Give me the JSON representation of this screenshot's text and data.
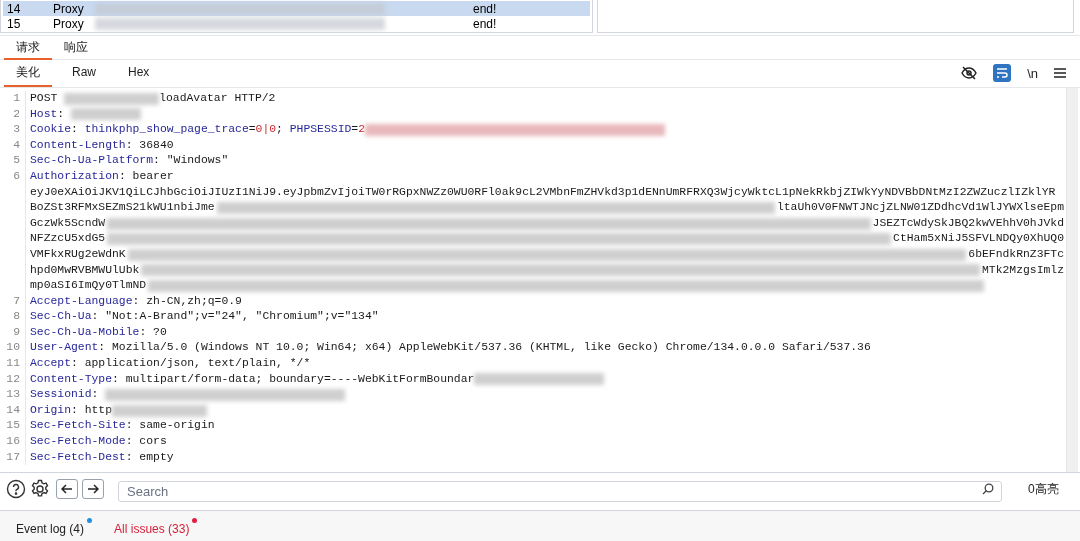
{
  "history_table": {
    "rows": [
      {
        "number": "14",
        "tool": "Proxy",
        "comment": "end!",
        "selected": true
      },
      {
        "number": "15",
        "tool": "Proxy",
        "comment": "end!",
        "selected": false
      }
    ]
  },
  "message_tabs": [
    {
      "label": "请求",
      "selected": true
    },
    {
      "label": "响应",
      "selected": false
    }
  ],
  "view_tabs": [
    {
      "label": "美化",
      "selected": true
    },
    {
      "label": "Raw",
      "selected": false
    },
    {
      "label": "Hex",
      "selected": false
    }
  ],
  "toolbar": {
    "newline_toggle": "\\n",
    "wrap_on": true
  },
  "request_lines": [
    {
      "number": "1",
      "parts": [
        {
          "kind": "plain",
          "text": "POST "
        },
        {
          "kind": "redacted"
        },
        {
          "kind": "plain",
          "text": "loadAvatar HTTP/2"
        }
      ]
    },
    {
      "number": "2",
      "parts": [
        {
          "kind": "key",
          "text": "Host"
        },
        {
          "kind": "plain",
          "text": ": "
        },
        {
          "kind": "redacted"
        }
      ]
    },
    {
      "number": "3",
      "parts": [
        {
          "kind": "key",
          "text": "Cookie"
        },
        {
          "kind": "plain",
          "text": ": "
        },
        {
          "kind": "key",
          "text": "thinkphp_show_page_trace"
        },
        {
          "kind": "plain",
          "text": "="
        },
        {
          "kind": "value",
          "text": "0|0"
        },
        {
          "kind": "plain",
          "text": "; "
        },
        {
          "kind": "key",
          "text": "PHPSESSID"
        },
        {
          "kind": "plain",
          "text": "="
        },
        {
          "kind": "value",
          "text": "2"
        },
        {
          "kind": "redacted_value"
        }
      ]
    },
    {
      "number": "4",
      "parts": [
        {
          "kind": "key",
          "text": "Content-Length"
        },
        {
          "kind": "plain",
          "text": ": 36840"
        }
      ]
    },
    {
      "number": "5",
      "parts": [
        {
          "kind": "key",
          "text": "Sec-Ch-Ua-Platform"
        },
        {
          "kind": "plain",
          "text": ": \"Windows\""
        }
      ]
    },
    {
      "number": "6",
      "parts": [
        {
          "kind": "key",
          "text": "Authorization"
        },
        {
          "kind": "plain",
          "text": ": bearer"
        }
      ],
      "wrapped": [
        {
          "parts": [
            {
              "kind": "plain",
              "text": "eyJ0eXAiOiJKV1QiLCJhbGciOiJIUzI1NiJ9.eyJpbmZvIjoiTW0rRGpxNWZz0WU0RFl0ak9cL2VMbnFmZHVkd3p1dENnUmRFRXQ3WjcyWktcL1pNekRkbjZIWkYyNDVBbDNtMzI2ZWZuczlIZklYR"
            }
          ]
        },
        {
          "parts": [
            {
              "kind": "plain",
              "text": "BoZSt3RFMxSEZmS21kWU1nbiJme"
            },
            {
              "kind": "redacted"
            },
            {
              "kind": "plain",
              "text": "ltaUh0V0FNWTJNcjZLNW01ZDdhcVd1WlJYWXlseEpm"
            }
          ]
        },
        {
          "parts": [
            {
              "kind": "plain",
              "text": "GczWk5ScndW"
            },
            {
              "kind": "redacted"
            },
            {
              "kind": "plain",
              "text": "JSEZTcWdySkJBQ2kwVEhhV0hJVkd"
            }
          ]
        },
        {
          "parts": [
            {
              "kind": "plain",
              "text": "NFZzcU5xdG5"
            },
            {
              "kind": "redacted"
            },
            {
              "kind": "plain",
              "text": "CtHam5xNiJ5SFVLNDQy0XhUQ0"
            }
          ]
        },
        {
          "parts": [
            {
              "kind": "plain",
              "text": "VMFkxRUg2eWdnK"
            },
            {
              "kind": "redacted"
            },
            {
              "kind": "plain",
              "text": "6bEFndkRnZ3FTc"
            }
          ]
        },
        {
          "parts": [
            {
              "kind": "plain",
              "text": "hpd0MwRVBMWUlUbk"
            },
            {
              "kind": "redacted"
            },
            {
              "kind": "plain",
              "text": "MTk2MzgsImlz"
            }
          ]
        },
        {
          "parts": [
            {
              "kind": "plain",
              "text": "mp0aSI6ImQy0TlmND"
            },
            {
              "kind": "redacted"
            }
          ]
        }
      ]
    },
    {
      "number": "7",
      "parts": [
        {
          "kind": "key",
          "text": "Accept-Language"
        },
        {
          "kind": "plain",
          "text": ": zh-CN,zh;q=0.9"
        }
      ]
    },
    {
      "number": "8",
      "parts": [
        {
          "kind": "key",
          "text": "Sec-Ch-Ua"
        },
        {
          "kind": "plain",
          "text": ": \"Not:A-Brand\";v=\"24\", \"Chromium\";v=\"134\""
        }
      ]
    },
    {
      "number": "9",
      "parts": [
        {
          "kind": "key",
          "text": "Sec-Ch-Ua-Mobile"
        },
        {
          "kind": "plain",
          "text": ": ?0"
        }
      ]
    },
    {
      "number": "10",
      "parts": [
        {
          "kind": "key",
          "text": "User-Agent"
        },
        {
          "kind": "plain",
          "text": ": Mozilla/5.0 (Windows NT 10.0; Win64; x64) AppleWebKit/537.36 (KHTML, like Gecko) Chrome/134.0.0.0 Safari/537.36"
        }
      ]
    },
    {
      "number": "11",
      "parts": [
        {
          "kind": "key",
          "text": "Accept"
        },
        {
          "kind": "plain",
          "text": ": application/json, text/plain, */*"
        }
      ]
    },
    {
      "number": "12",
      "parts": [
        {
          "kind": "key",
          "text": "Content-Type"
        },
        {
          "kind": "plain",
          "text": ": multipart/form-data; boundary=----WebKitFormBoundar"
        },
        {
          "kind": "redacted"
        }
      ]
    },
    {
      "number": "13",
      "parts": [
        {
          "kind": "key",
          "text": "Sessionid"
        },
        {
          "kind": "plain",
          "text": ": "
        },
        {
          "kind": "redacted"
        }
      ]
    },
    {
      "number": "14",
      "parts": [
        {
          "kind": "key",
          "text": "Origin"
        },
        {
          "kind": "plain",
          "text": ": http"
        },
        {
          "kind": "redacted"
        }
      ]
    },
    {
      "number": "15",
      "parts": [
        {
          "kind": "key",
          "text": "Sec-Fetch-Site"
        },
        {
          "kind": "plain",
          "text": ": same-origin"
        }
      ]
    },
    {
      "number": "16",
      "parts": [
        {
          "kind": "key",
          "text": "Sec-Fetch-Mode"
        },
        {
          "kind": "plain",
          "text": ": cors"
        }
      ]
    },
    {
      "number": "17",
      "parts": [
        {
          "kind": "key",
          "text": "Sec-Fetch-Dest"
        },
        {
          "kind": "plain",
          "text": ": empty"
        }
      ]
    }
  ],
  "search": {
    "placeholder": "Search",
    "matches": "0高亮"
  },
  "footer_tabs": [
    {
      "label": "Event log (4)",
      "kind": "info",
      "color": "#1e90e0"
    },
    {
      "label": "All issues (33)",
      "kind": "issues",
      "color": "#e0203c"
    }
  ]
}
